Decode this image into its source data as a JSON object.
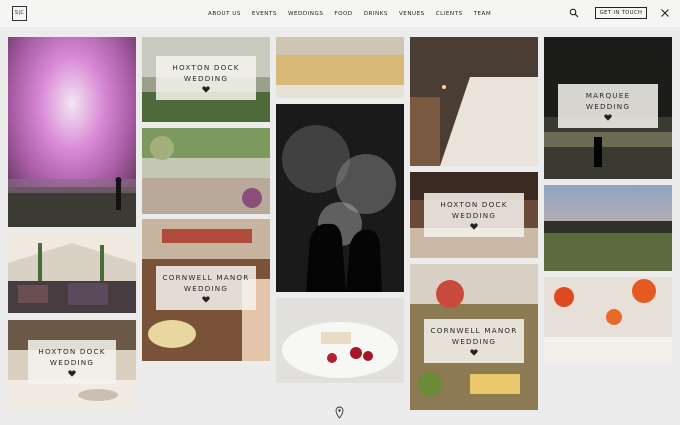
{
  "brand": {
    "logo_text": "S|C"
  },
  "nav": {
    "items": [
      "ABOUT US",
      "EVENTS",
      "WEDDINGS",
      "FOOD",
      "DRINKS",
      "VENUES",
      "CLIENTS",
      "TEAM"
    ],
    "cta_label": "GET IN TOUCH"
  },
  "icons": {
    "search": "search-icon",
    "close": "close-icon",
    "heart": "heart-icon",
    "scroll": "location-pin-icon"
  },
  "tiles": [
    {
      "id": "fireworks-pink",
      "label": null
    },
    {
      "id": "hoxton-dock-top",
      "label": [
        "HOXTON DOCK",
        "WEDDING"
      ]
    },
    {
      "id": "champagne-glasses",
      "label": null
    },
    {
      "id": "long-table",
      "label": null
    },
    {
      "id": "marquee-night",
      "label": [
        "MARQUEE",
        "WEDDING"
      ]
    },
    {
      "id": "garden-party",
      "label": null
    },
    {
      "id": "couple-fireworks",
      "label": null
    },
    {
      "id": "hoxton-dock-middle",
      "label": [
        "HOXTON DOCK",
        "WEDDING"
      ]
    },
    {
      "id": "tent-guests",
      "label": null
    },
    {
      "id": "cornwell-manor-left",
      "label": [
        "CORNWELL MANOR",
        "WEDDING"
      ]
    },
    {
      "id": "sunset-tents",
      "label": null
    },
    {
      "id": "plated-dessert",
      "label": null
    },
    {
      "id": "hoxton-dock-bottom",
      "label": [
        "HOXTON DOCK",
        "WEDDING"
      ]
    },
    {
      "id": "cornwell-manor-right",
      "label": [
        "CORNWELL MANOR",
        "WEDDING"
      ]
    },
    {
      "id": "flower-glasses",
      "label": null
    }
  ],
  "colors": {
    "page_bg": "#ececec",
    "header_bg": "#f5f5f3",
    "label_bg": "#f5f3ee",
    "text": "#222222"
  }
}
